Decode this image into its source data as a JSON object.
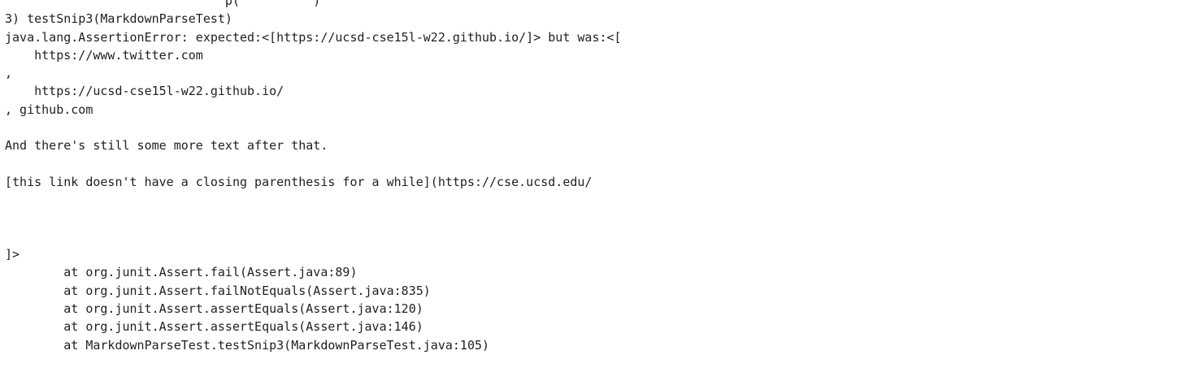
{
  "terminal": {
    "lines": [
      "                              p(          )",
      "3) testSnip3(MarkdownParseTest)",
      "java.lang.AssertionError: expected:<[https://ucsd-cse15l-w22.github.io/]> but was:<[",
      "    https://www.twitter.com",
      ",",
      "    https://ucsd-cse15l-w22.github.io/",
      ", github.com",
      "",
      "And there's still some more text after that.",
      "",
      "[this link doesn't have a closing parenthesis for a while](https://cse.ucsd.edu/",
      "",
      "",
      "",
      "]>",
      "        at org.junit.Assert.fail(Assert.java:89)",
      "        at org.junit.Assert.failNotEquals(Assert.java:835)",
      "        at org.junit.Assert.assertEquals(Assert.java:120)",
      "        at org.junit.Assert.assertEquals(Assert.java:146)",
      "        at MarkdownParseTest.testSnip3(MarkdownParseTest.java:105)"
    ]
  }
}
